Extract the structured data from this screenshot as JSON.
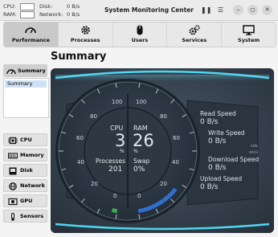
{
  "titlebar": {
    "cpu_label": "CPU:",
    "ram_label": "RAM:",
    "disk_label": "Disk:",
    "disk_value": "0 B/s",
    "network_label": "Network:",
    "network_value": "0 B/s",
    "title": "System Monitoring Center"
  },
  "tabs": [
    {
      "label": "Performance",
      "icon": "gauge-icon",
      "active": true
    },
    {
      "label": "Processes",
      "icon": "gear-icon",
      "active": false
    },
    {
      "label": "Users",
      "icon": "mouse-icon",
      "active": false
    },
    {
      "label": "Services",
      "icon": "gears-icon",
      "active": false
    },
    {
      "label": "System",
      "icon": "monitor-icon",
      "active": false
    }
  ],
  "sidebar": {
    "summary_header": "Summary",
    "summary_item": "Summary",
    "items": [
      {
        "label": "CPU",
        "icon": "cpu-icon"
      },
      {
        "label": "Memory",
        "icon": "memory-icon"
      },
      {
        "label": "Disk",
        "icon": "disk-icon"
      },
      {
        "label": "Network",
        "icon": "network-icon"
      },
      {
        "label": "GPU",
        "icon": "gpu-icon"
      },
      {
        "label": "Sensors",
        "icon": "sensors-icon"
      }
    ]
  },
  "main": {
    "title": "Summary",
    "gauge": {
      "left_ticks": [
        "100",
        "80",
        "60",
        "40",
        "20",
        "0"
      ],
      "right_ticks": [
        "100",
        "80",
        "60",
        "40",
        "20",
        "0"
      ],
      "cpu_label": "CPU",
      "cpu_value": "3",
      "cpu_unit": "%",
      "ram_label": "RAM",
      "ram_value": "26",
      "ram_unit": "%",
      "processes_label": "Processes",
      "processes_value": "201",
      "swap_label": "Swap",
      "swap_value": "0%",
      "cpu_percent": 3,
      "ram_percent": 26
    },
    "speeds": {
      "read_label": "Read Speed",
      "read_value": "0 B/s",
      "write_label": "Write Speed",
      "write_value": "0 B/s",
      "device1": "sda",
      "download_label": "Download Speed",
      "download_value": "0 B/s",
      "device2": "wlo1",
      "upload_label": "Upload Speed",
      "upload_value": "0 B/s"
    }
  },
  "colors": {
    "panel_bg": "#34404c",
    "accent_cyan": "#40c8e8",
    "ram_arc": "#2f6fd0",
    "cpu_arc": "#3fae49",
    "text_light": "#dde3e8"
  }
}
